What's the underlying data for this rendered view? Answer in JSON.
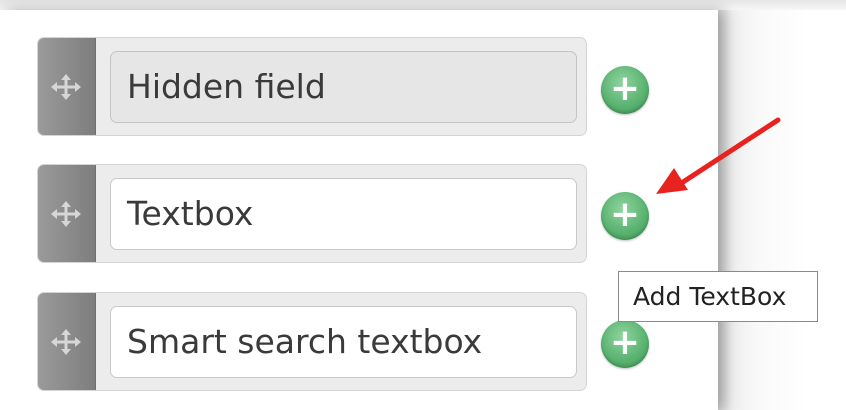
{
  "fields": [
    {
      "label": "Hidden field",
      "state": "disabled",
      "move_icon": "move-icon",
      "add_icon": "plus-circle-icon"
    },
    {
      "label": "Textbox",
      "state": "enabled",
      "move_icon": "move-icon",
      "add_icon": "plus-circle-icon"
    },
    {
      "label": "Smart search textbox",
      "state": "enabled",
      "move_icon": "move-icon",
      "add_icon": "plus-circle-icon"
    }
  ],
  "add_button_symbol": "+",
  "tooltip": {
    "text": "Add TextBox"
  },
  "annotation": {
    "type": "arrow",
    "color": "#e8231f",
    "points_to": "Textbox add button"
  },
  "colors": {
    "add_button": "#5cb472",
    "handle": "#8a8a8a",
    "field_disabled_bg": "#e6e6e6",
    "arrow": "#e8231f"
  }
}
